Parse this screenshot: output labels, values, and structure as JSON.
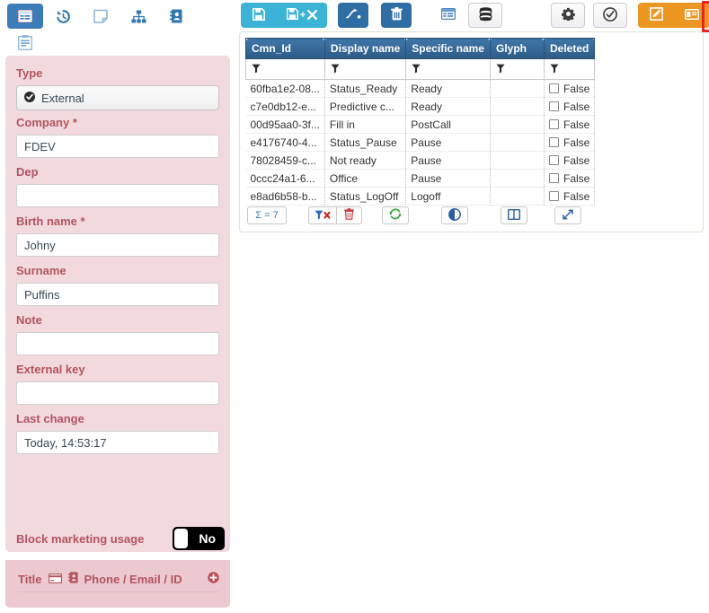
{
  "left_nav": {
    "items": [
      {
        "name": "grid-view-icon",
        "label": "Grid view",
        "active": true
      },
      {
        "name": "history-icon",
        "label": "History",
        "active": false
      },
      {
        "name": "note-icon",
        "label": "Note",
        "active": false
      },
      {
        "name": "hierarchy-icon",
        "label": "Hierarchy",
        "active": false
      },
      {
        "name": "address-book-icon",
        "label": "Address book",
        "active": false
      },
      {
        "name": "form-icon",
        "label": "Form",
        "active": false
      }
    ],
    "active_color": "#3b7cb9",
    "icon_color": "#3b7cb9"
  },
  "toolbar": {
    "save_label": "Save",
    "save_close_label": "Save and close",
    "merge_label": "Merge",
    "delete_label": "Delete",
    "grid_label": "Grid",
    "database_label": "Database",
    "settings_label": "Settings",
    "approve_label": "Approve",
    "edit_label": "Edit",
    "card_label": "Card",
    "colors": {
      "cyan": "#3bb3d6",
      "blue": "#2f6da5",
      "orange": "#ec9722",
      "highlight": "#ee2222"
    }
  },
  "form": {
    "panel_color": "#f2d9de",
    "label_color": "#b3545e",
    "fields": [
      {
        "label": "Type",
        "value": "External",
        "type": "select",
        "required": false
      },
      {
        "label": "Company *",
        "value": "FDEV",
        "type": "text",
        "required": true
      },
      {
        "label": "Dep",
        "value": "",
        "type": "text",
        "required": false
      },
      {
        "label": "Birth name *",
        "value": "Johny",
        "type": "text",
        "required": true
      },
      {
        "label": "Surname",
        "value": "Puffins",
        "type": "text",
        "required": false
      },
      {
        "label": "Note",
        "value": "",
        "type": "text",
        "required": false
      },
      {
        "label": "External key",
        "value": "",
        "type": "text",
        "required": false
      },
      {
        "label": "Last change",
        "value": "Today, 14:53:17",
        "type": "text",
        "required": false
      }
    ],
    "toggle": {
      "label": "Block marketing usage",
      "value": "No"
    },
    "contacts": {
      "title_label": "Title",
      "columns_label": "Phone / Email / ID",
      "add_label": "Add"
    }
  },
  "grid": {
    "columns": [
      "Cmn_Id",
      "Display name",
      "Specific name",
      "Glyph",
      "Deleted"
    ],
    "filter_icon": "filter-icon",
    "rows": [
      {
        "cmn_id": "60fba1e2-08...",
        "display_name": "Status_Ready",
        "specific_name": "Ready",
        "glyph": "",
        "deleted": "False"
      },
      {
        "cmn_id": "c7e0db12-e...",
        "display_name": "Predictive c...",
        "specific_name": "Ready",
        "glyph": "",
        "deleted": "False"
      },
      {
        "cmn_id": "00d95aa0-3f...",
        "display_name": "Fill in",
        "specific_name": "PostCall",
        "glyph": "",
        "deleted": "False"
      },
      {
        "cmn_id": "e4176740-4...",
        "display_name": "Status_Pause",
        "specific_name": "Pause",
        "glyph": "",
        "deleted": "False"
      },
      {
        "cmn_id": "78028459-c...",
        "display_name": "Not ready",
        "specific_name": "Pause",
        "glyph": "",
        "deleted": "False"
      },
      {
        "cmn_id": "0ccc24a1-6...",
        "display_name": "Office",
        "specific_name": "Pause",
        "glyph": "",
        "deleted": "False"
      },
      {
        "cmn_id": "e8ad6b58-b...",
        "display_name": "Status_LogOff",
        "specific_name": "Logoff",
        "glyph": "",
        "deleted": "False"
      }
    ],
    "footer": {
      "count_label": "Σ = 7",
      "clear_filter_label": "Clear filter",
      "delete_label": "Delete",
      "refresh_label": "Refresh",
      "contrast_label": "Contrast",
      "columns_label": "Columns",
      "expand_label": "Expand"
    }
  }
}
